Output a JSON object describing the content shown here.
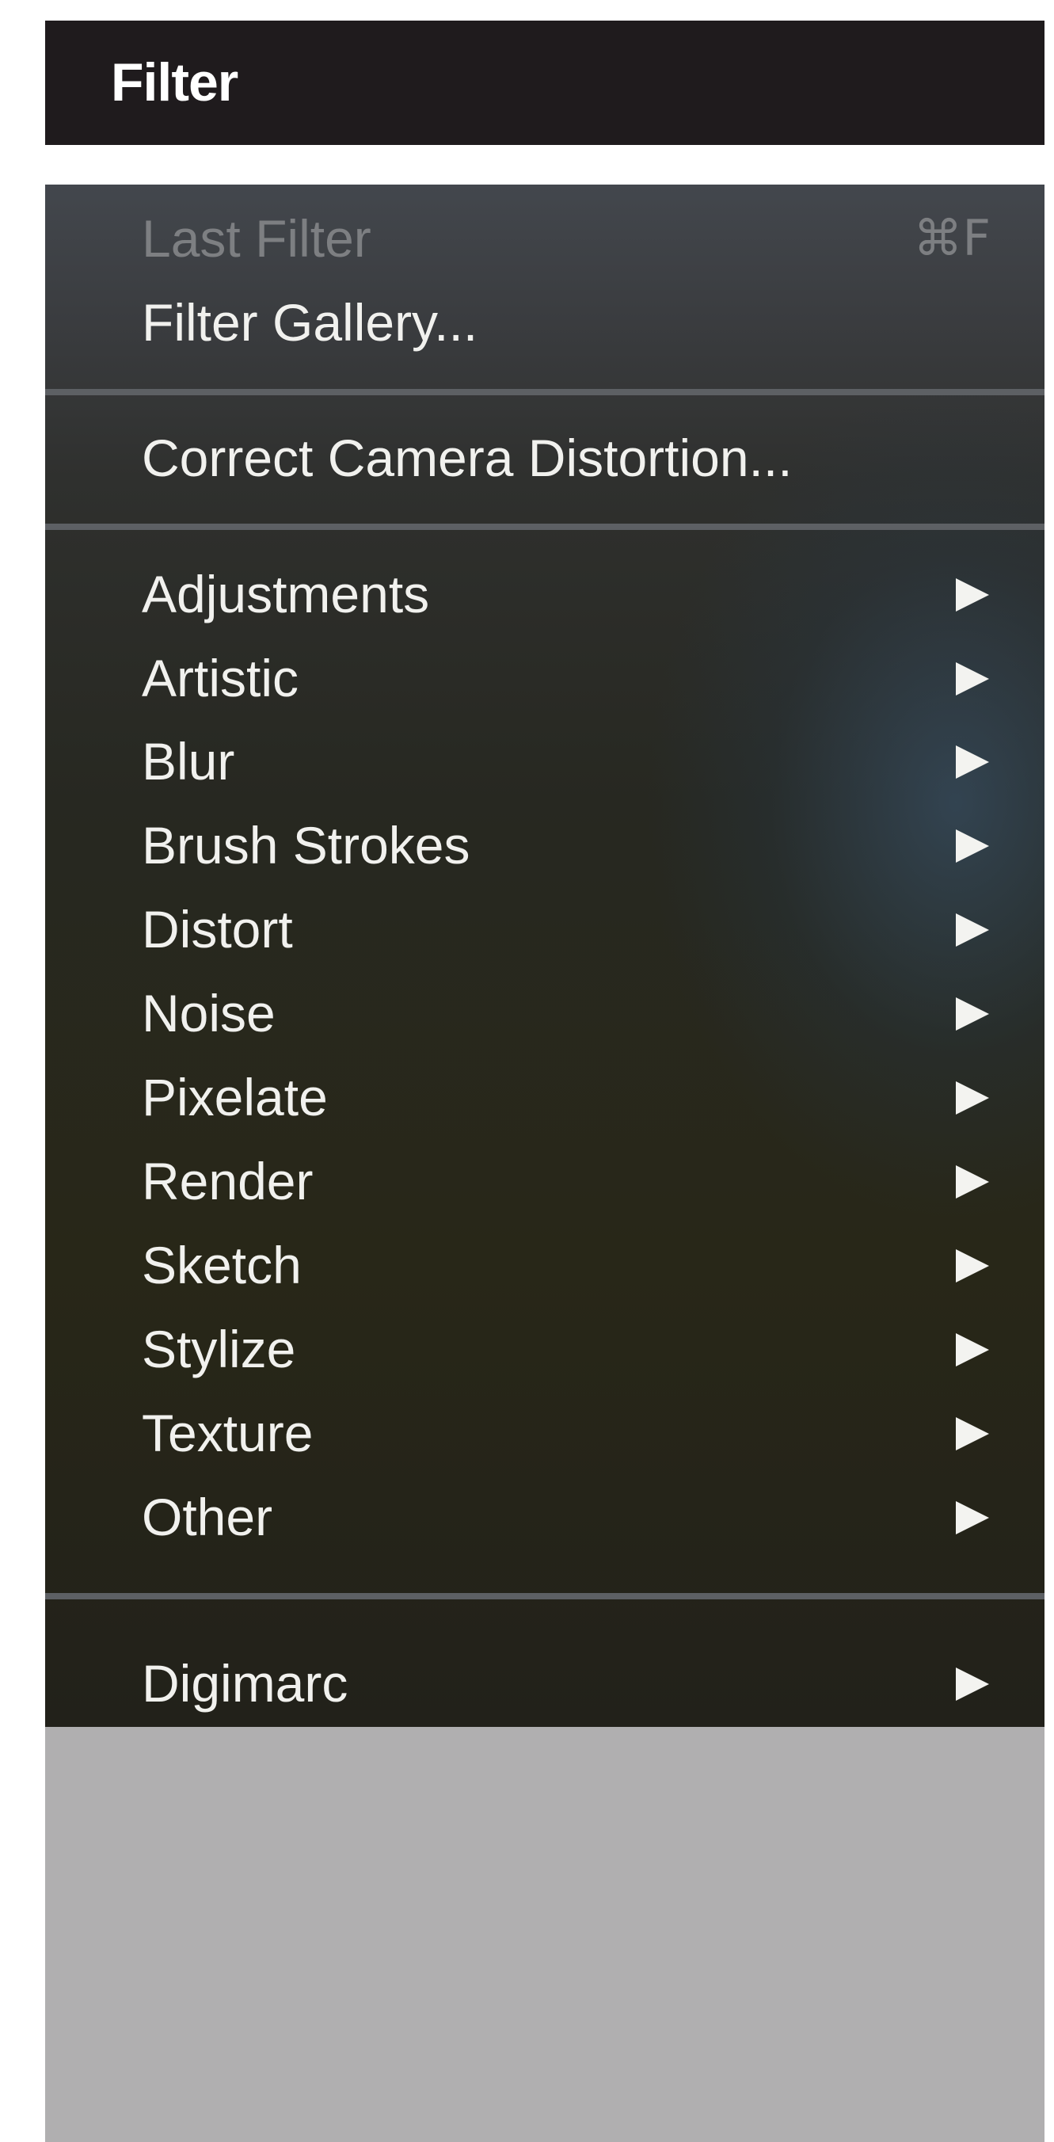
{
  "menu_bar": {
    "title": "Filter"
  },
  "menu": {
    "last_filter": {
      "label": "Last Filter",
      "shortcut": "⌘F",
      "enabled": false
    },
    "filter_gallery": {
      "label": "Filter Gallery..."
    },
    "correct_camera_distortion": {
      "label": "Correct Camera Distortion..."
    },
    "submenus": [
      {
        "label": "Adjustments"
      },
      {
        "label": "Artistic"
      },
      {
        "label": "Blur"
      },
      {
        "label": "Brush Strokes"
      },
      {
        "label": "Distort"
      },
      {
        "label": "Noise"
      },
      {
        "label": "Pixelate"
      },
      {
        "label": "Render"
      },
      {
        "label": "Sketch"
      },
      {
        "label": "Stylize"
      },
      {
        "label": "Texture"
      },
      {
        "label": "Other"
      }
    ],
    "digimarc": {
      "label": "Digimarc"
    }
  },
  "icons": {
    "submenu_arrow": "triangle-right-icon"
  },
  "colors": {
    "menu_bar_bg": "#1f1b1d",
    "menu_text": "#f1f1ee",
    "disabled_text": "#7d7f82",
    "separator": "#5d6064",
    "footer_bg": "#b0afb0"
  }
}
